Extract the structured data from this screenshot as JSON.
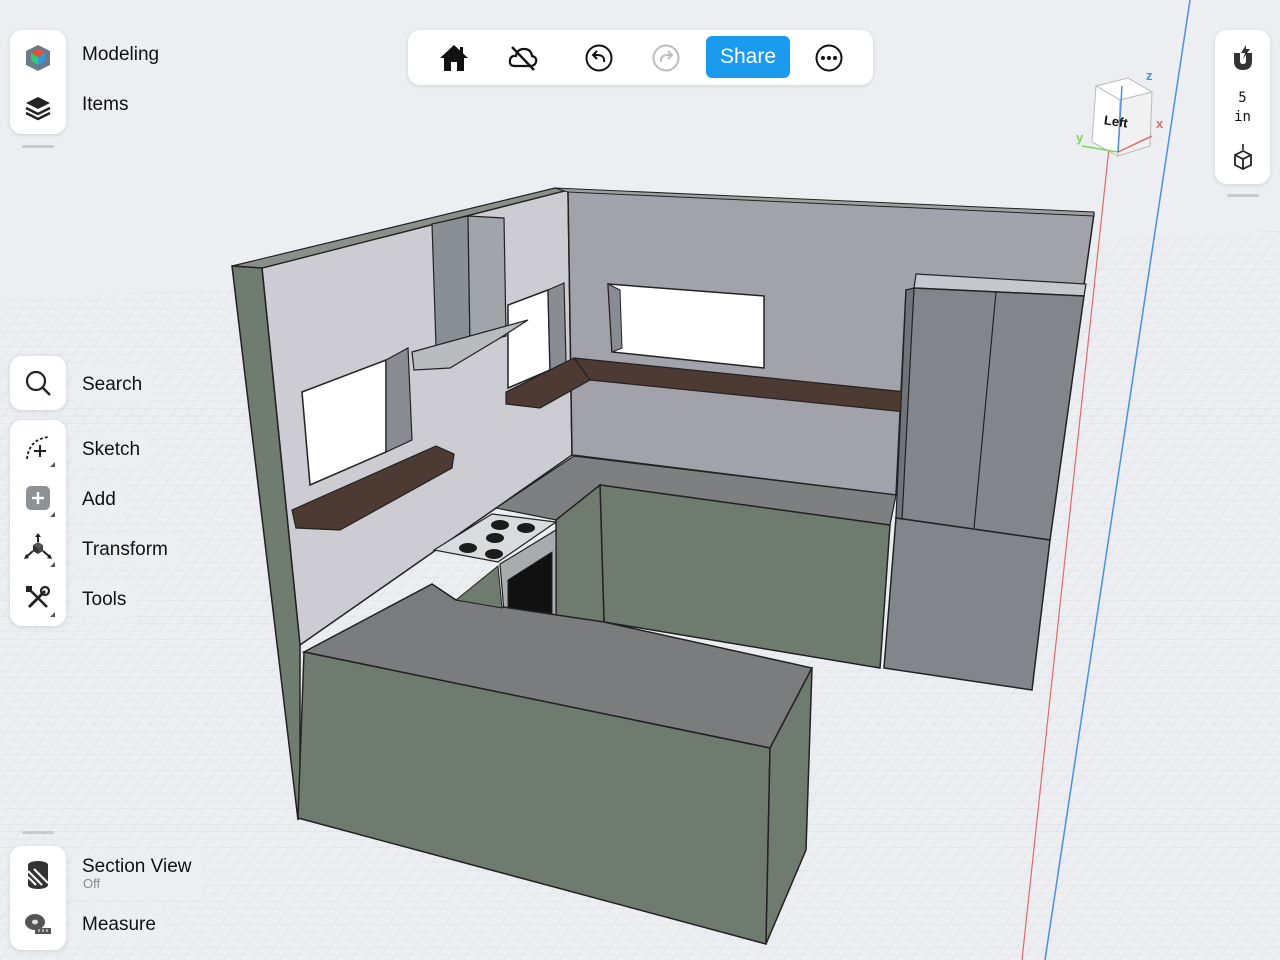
{
  "left_toolbar": {
    "modeling_label": "Modeling",
    "items_label": "Items"
  },
  "tools": {
    "search_label": "Search",
    "sketch_label": "Sketch",
    "add_label": "Add",
    "transform_label": "Transform",
    "tools_label": "Tools"
  },
  "bottom_tools": {
    "section_view_label": "Section View",
    "section_view_status": "Off",
    "measure_label": "Measure"
  },
  "top_toolbar": {
    "share_label": "Share"
  },
  "right_panel": {
    "snap_value": "5",
    "snap_unit": "in"
  },
  "view_cube": {
    "face_label": "Left",
    "axis_x": "x",
    "axis_y": "y",
    "axis_z": "z"
  },
  "colors": {
    "accent": "#1a9bf0",
    "cabinet": "#6f7b6e",
    "wall": "#a2a2aa",
    "shelf": "#4c3a33"
  }
}
